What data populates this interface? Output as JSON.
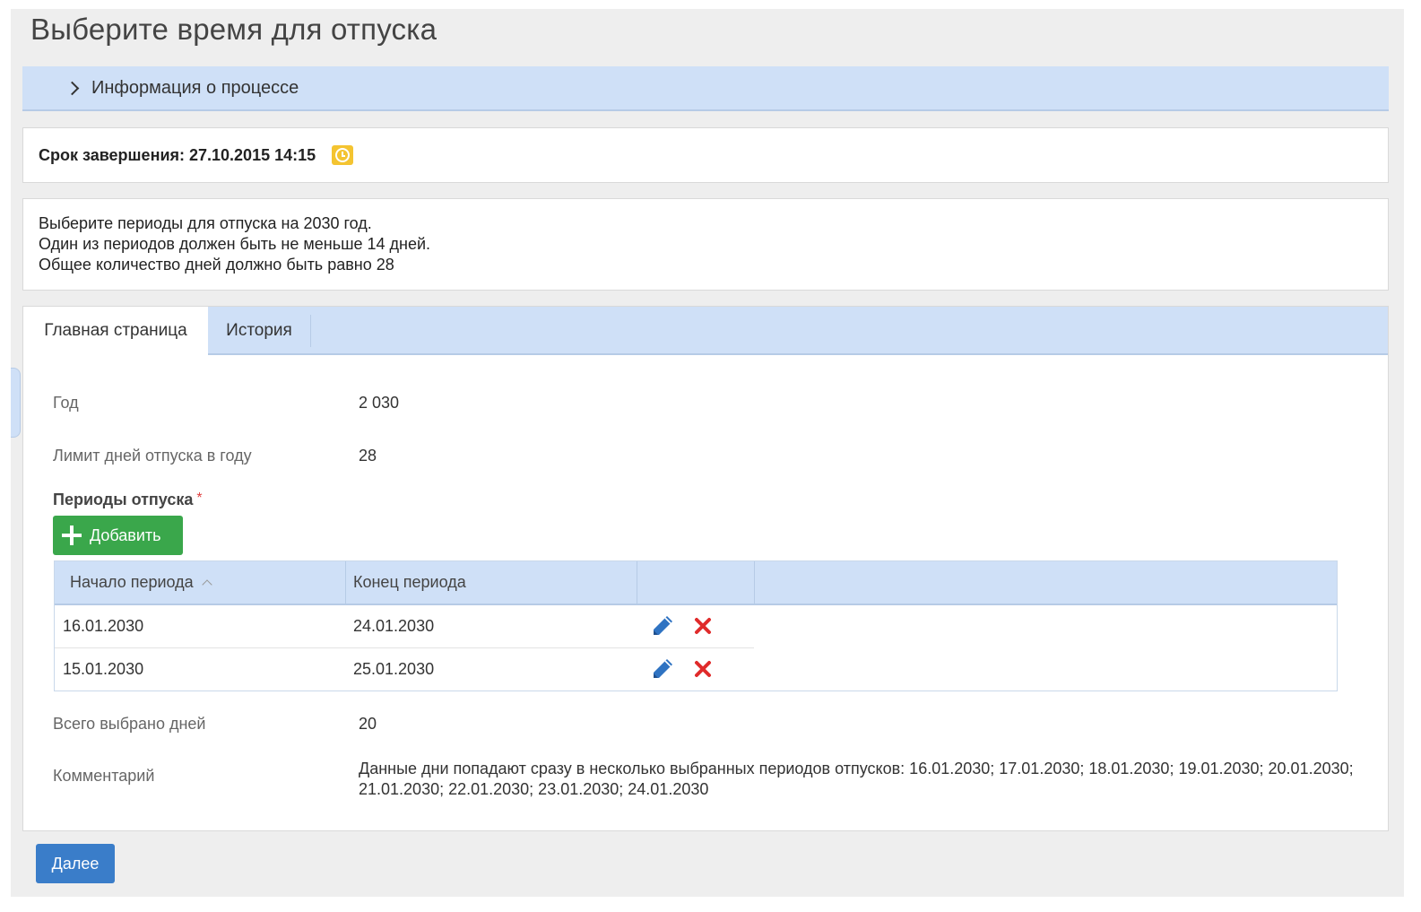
{
  "page": {
    "title": "Выберите время для отпуска"
  },
  "process_info": {
    "label": "Информация о процессе"
  },
  "deadline": {
    "text": "Срок завершения: 27.10.2015 14:15",
    "icon": "clock-icon",
    "icon_color": "#f4c431"
  },
  "instructions": {
    "lines": [
      "Выберите периоды для отпуска на 2030 год.",
      "Один из периодов должен быть не меньше 14 дней.",
      "Общее количество дней должно быть равно 28"
    ]
  },
  "tabs": [
    {
      "label": "Главная страница",
      "active": true
    },
    {
      "label": "История",
      "active": false
    }
  ],
  "fields": {
    "year": {
      "label": "Год",
      "value": "2 030"
    },
    "limit": {
      "label": "Лимит дней отпуска в году",
      "value": "28"
    },
    "total": {
      "label": "Всего выбрано дней",
      "value": "20"
    },
    "comment": {
      "label": "Комментарий",
      "value": "Данные дни попадают сразу в несколько выбранных периодов отпусков: 16.01.2030; 17.01.2030; 18.01.2030; 19.01.2030; 20.01.2030; 21.01.2030; 22.01.2030; 23.01.2030; 24.01.2030"
    }
  },
  "periods": {
    "title": "Периоды отпуска",
    "required_mark": "*",
    "add_label": "Добавить",
    "columns": [
      "Начало периода",
      "Конец периода"
    ],
    "rows": [
      {
        "start": "16.01.2030",
        "end": "24.01.2030"
      },
      {
        "start": "15.01.2030",
        "end": "25.01.2030"
      }
    ]
  },
  "footer": {
    "next_label": "Далее"
  },
  "colors": {
    "header_blue": "#cfe0f7",
    "add_green": "#3aa74b",
    "next_blue": "#3a7dc9",
    "edit_blue": "#2f73c2",
    "delete_red": "#e02b2b"
  }
}
